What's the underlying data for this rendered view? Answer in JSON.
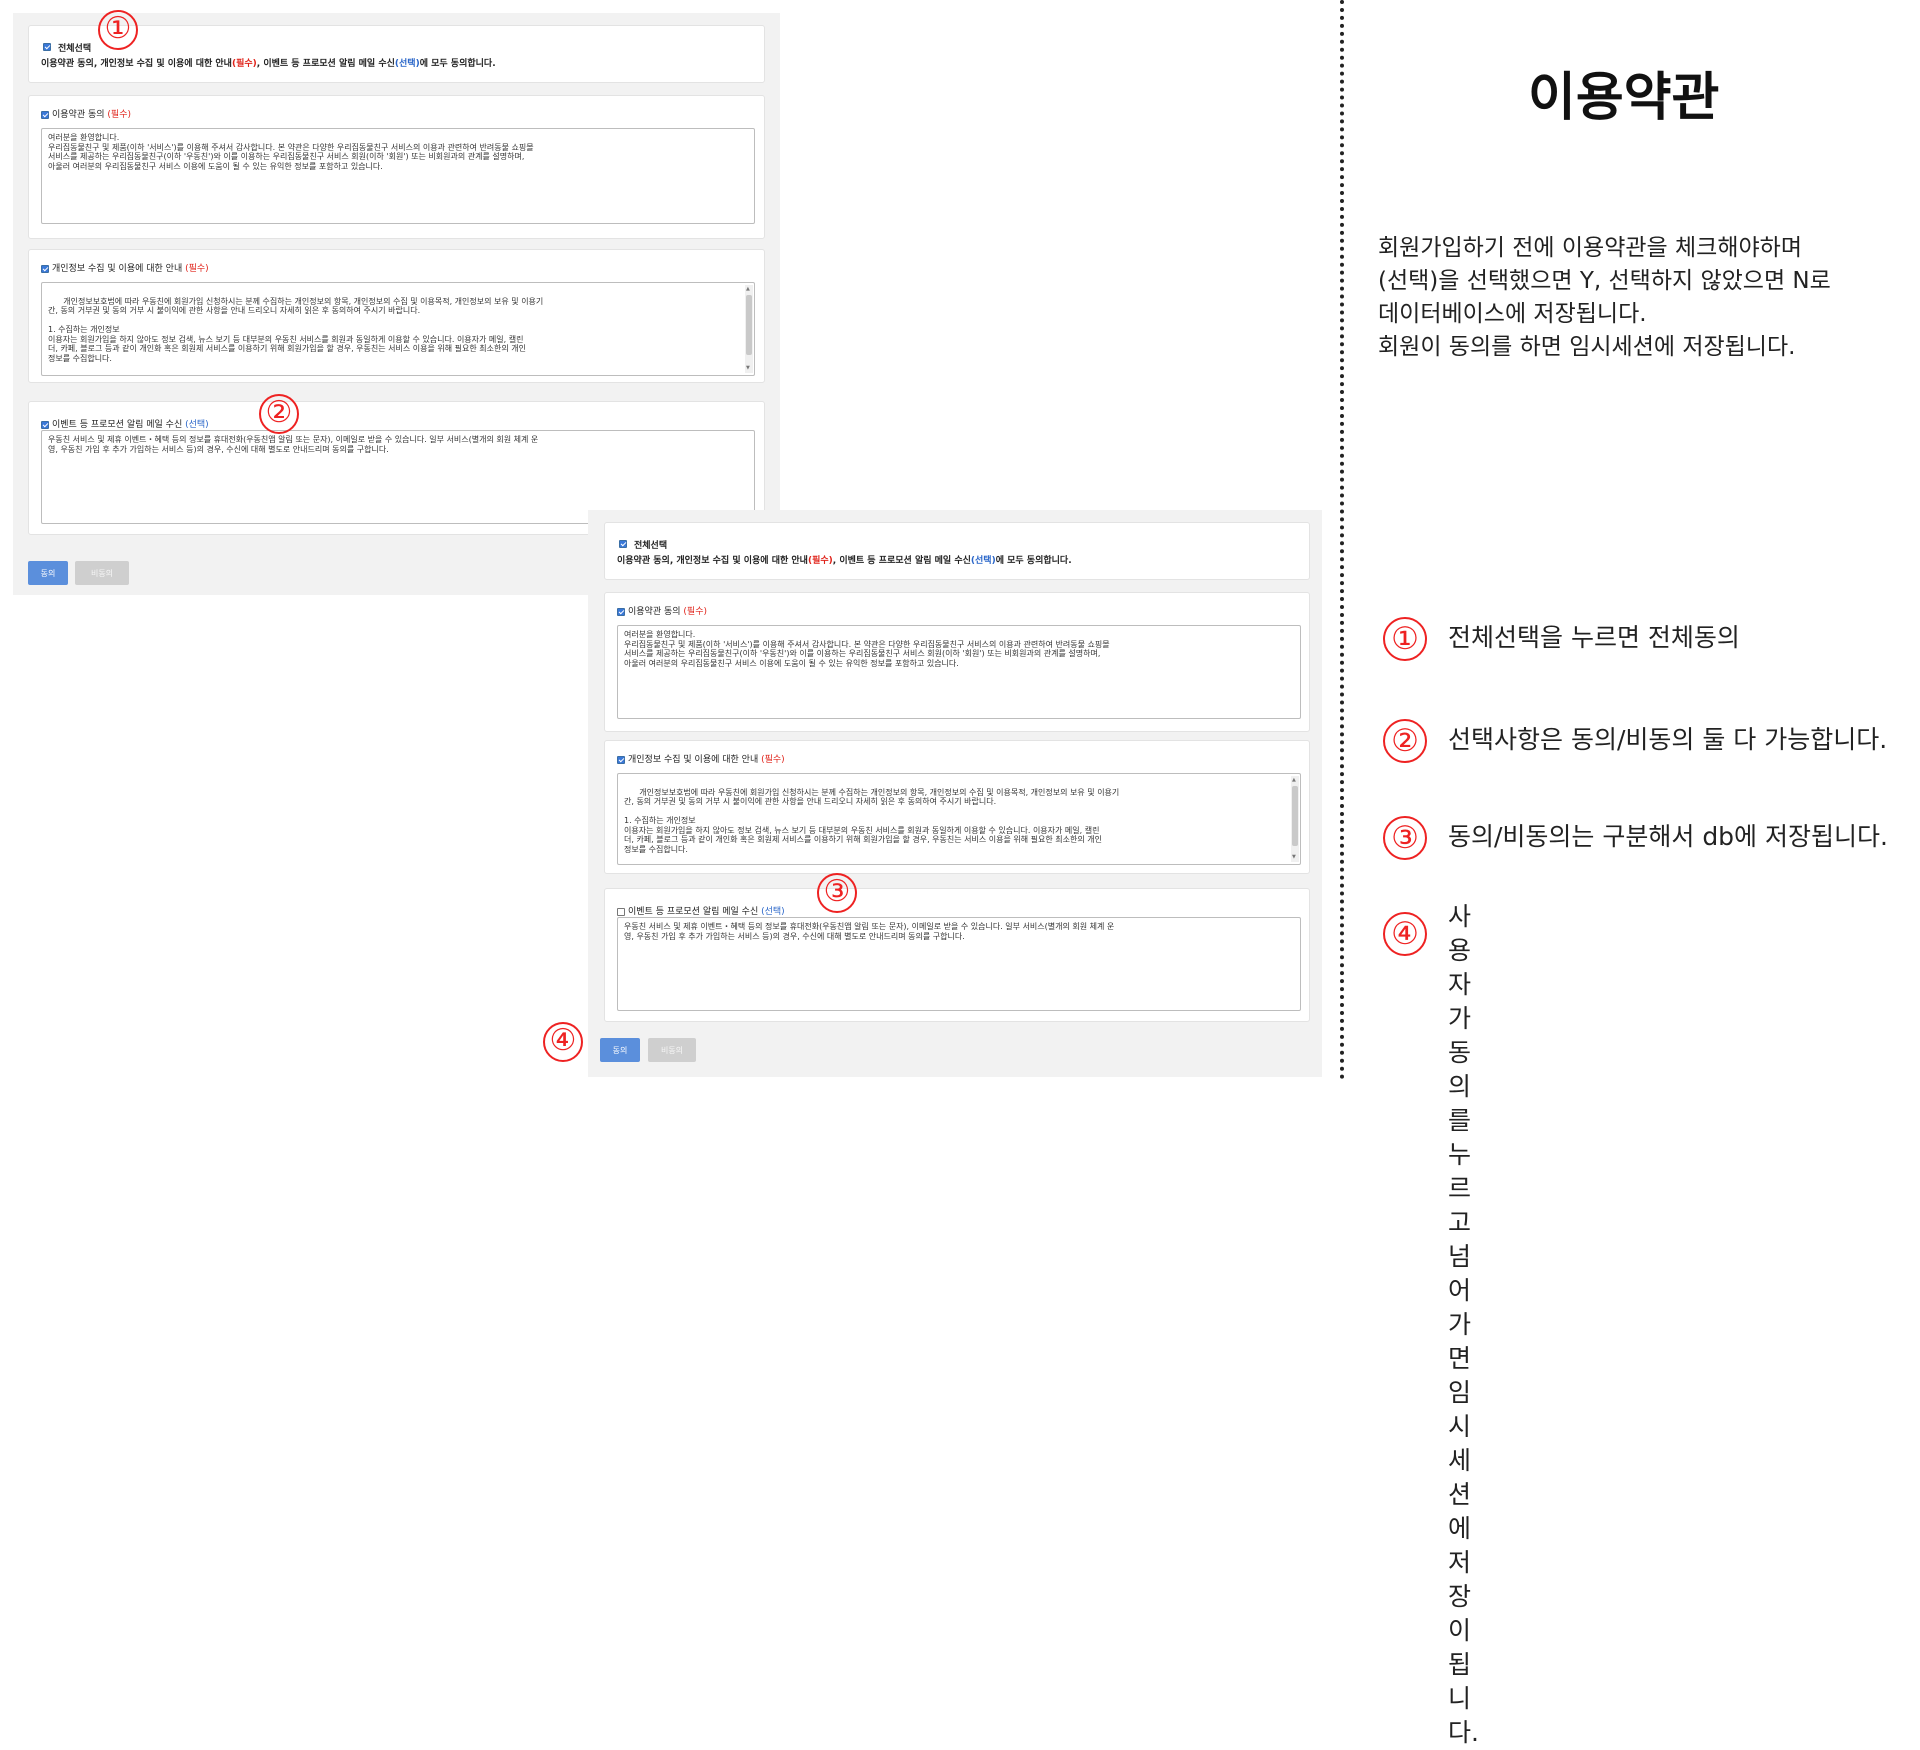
{
  "form": {
    "all_select_label": "전체선택",
    "all_desc_prefix": "이용약관 동의, 개인정보 수집 및 이용에 대한 안내",
    "required_tag": "(필수)",
    "all_desc_mid": ", 이벤트 등 프로모션 알림 메일 수신",
    "optional_tag": "(선택)",
    "all_desc_suffix": "에 모두 동의합니다.",
    "terms_title": "이용약관 동의 ",
    "terms_text": "여러분을 환영합니다.\n우리집동물친구 및 제품(이하 '서비스')를 이용해 주셔서 감사합니다. 본 약관은 다양한 우리집동물친구 서비스의 이용과 관련하여 반려동물 쇼핑몰\n서비스를 제공하는 우리집동물친구(이하 '우동친')와 이를 이용하는 우리집동물친구 서비스 회원(이하 '회원') 또는 비회원과의 관계를 설명하며,\n아울러 여러분의 우리집동물친구 서비스 이용에 도움이 될 수 있는 유익한 정보를 포함하고 있습니다.",
    "privacy_title": "개인정보 수집 및 이용에 대한 안내 ",
    "privacy_text": "개인정보보호법에 따라 우동친에 회원가입 신청하시는 분께 수집하는 개인정보의 항목, 개인정보의 수집 및 이용목적, 개인정보의 보유 및 이용기\n간, 동의 거부권 및 동의 거부 시 불이익에 관한 사항을 안내 드리오니 자세히 읽은 후 동의하여 주시기 바랍니다.\n\n1. 수집하는 개인정보\n이용자는 회원가입을 하지 않아도 정보 검색, 뉴스 보기 등 대부분의 우동친 서비스를 회원과 동일하게 이용할 수 있습니다. 이용자가 메일, 캘린\n더, 카페, 블로그 등과 같이 개인화 혹은 회원제 서비스를 이용하기 위해 회원가입을 할 경우, 우동친는 서비스 이용을 위해 필요한 최소한의 개인\n정보를 수집합니다.",
    "event_title": "이벤트 등 프로모션 알림 메일 수신 ",
    "event_text": "우동친 서비스 및 제휴 이벤트・혜택 등의 정보를 휴대전화(우동친앱 알림 또는 문자), 이메일로 받을 수 있습니다. 일부 서비스(별개의 회원 체계 운\n영, 우동친 가입 후 추가 가입하는 서비스 등)의 경우, 수신에 대해 별도로 안내드리며 동의를 구합니다.",
    "agree_label": "동의",
    "disagree_label": "비동의"
  },
  "checkbox_states": {
    "shot_a": {
      "all": true,
      "terms": true,
      "privacy": true,
      "event": true
    },
    "shot_b": {
      "all": true,
      "terms": true,
      "privacy": true,
      "event": false
    }
  },
  "markers": [
    "①",
    "②",
    "③",
    "④"
  ],
  "doc": {
    "title": "이용약관",
    "description": [
      "회원가입하기 전에 이용약관을 체크해야하며",
      "(선택)을 선택했으면 Y, 선택하지 않았으면 N로",
      "데이터베이스에 저장됩니다.",
      "회원이 동의를 하면 임시세션에 저장됩니다."
    ],
    "legend": [
      {
        "num": "①",
        "text": "전체선택을 누르면 전체동의"
      },
      {
        "num": "②",
        "text": "선택사항은 동의/비동의 둘 다 가능합니다."
      },
      {
        "num": "③",
        "text": "동의/비동의는 구분해서 db에 저장됩니다."
      },
      {
        "num": "④",
        "text": "사용자가 동의를 누르고 넘어가면\n임시세션에 저장이 됩니다."
      }
    ]
  },
  "colors": {
    "required": "#e0241b",
    "optional": "#2a66c9",
    "marker": "#ee2222",
    "agree_button": "#5b8fdc"
  }
}
